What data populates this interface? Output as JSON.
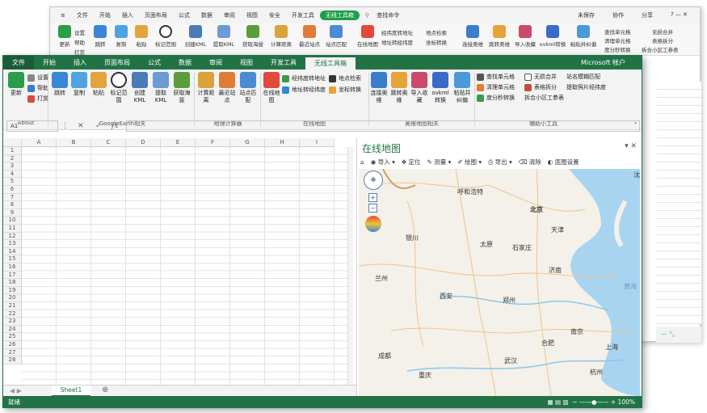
{
  "back_window": {
    "menu": [
      "文件",
      "开始",
      "插入",
      "页面布局",
      "公式",
      "数据",
      "审阅",
      "视图",
      "安全",
      "开发工具"
    ],
    "active_tab": "无线工具箱",
    "search": "查找命令",
    "right": [
      "未保存",
      "协作",
      "分享"
    ],
    "ribbon": {
      "b1": "更新",
      "b2": "设置",
      "b2b": "帮助",
      "b2c": "打赏",
      "b3": "跳转",
      "b4": "复制",
      "b5": "粘贴",
      "b6": "标记范围",
      "b7": "创建KML",
      "b8": "提取KML",
      "b9": "获取海拔",
      "b10": "计算距离",
      "b11": "最近站点",
      "b12": "站点匹配",
      "b13": "在线地图",
      "s1": "经纬度转地址",
      "s2": "地址转经纬度",
      "s3": "地点检索",
      "s4": "坐标转换",
      "b14": "连接奥维",
      "b15": "跳转奥维",
      "b16": "导入收藏",
      "b17": "ovkml转换",
      "b18": "粘贴并纠偏",
      "s5": "查找单元格",
      "s6": "清理单元格",
      "s7": "度分秒转换",
      "s8": "无损合并",
      "s9": "表格拆分",
      "s10": "拆合小区工参表"
    },
    "col": "T"
  },
  "tabs": [
    "文件",
    "开始",
    "插入",
    "页面布局",
    "公式",
    "数据",
    "审阅",
    "视图",
    "开发工具"
  ],
  "active_tab": "无线工具箱",
  "account": "Microsoft 帐户",
  "ribbon": {
    "update": "更新",
    "settings": "设置",
    "help": "帮助",
    "donate": "打赏",
    "about": "About",
    "jump": "跳转",
    "copy": "复制",
    "paste": "粘贴",
    "mark": "标记范围",
    "createkml": "创建KML",
    "extractkml": "提取KML",
    "altitude": "获取海拔",
    "group_ge": "GoogleEarth相关",
    "distance": "计算距离",
    "nearest": "最近站点",
    "match": "站点匹配",
    "group_calc": "地理计算器",
    "online": "在线地图",
    "geo2addr": "经纬度转地址",
    "addr2geo": "地址转经纬度",
    "poi": "地点检索",
    "coord": "坐标转换",
    "group_online": "在线地图",
    "ovconn": "连接奥维",
    "ovjump": "跳转奥维",
    "ovimport": "导入收藏",
    "ovkml": "ovkml转换",
    "ovpaste": "粘贴并纠偏",
    "group_ov": "奥维地图相关",
    "findcell": "查找单元格",
    "cleancell": "清理单元格",
    "dms": "度分秒转换",
    "merge": "无损合并",
    "split": "表格拆分",
    "splitcell": "拆合小区工参表",
    "stationmatch": "站名模糊匹配",
    "photo": "提取照片经纬度",
    "group_tools": "辅助小工具"
  },
  "namebox": "A1",
  "fx": "fx",
  "columns": [
    "A",
    "B",
    "C",
    "D",
    "E",
    "F",
    "G",
    "H",
    "I"
  ],
  "rows": [
    "1",
    "2",
    "3",
    "4",
    "5",
    "6",
    "7",
    "8",
    "9",
    "10",
    "11",
    "12",
    "13",
    "14",
    "15",
    "16",
    "17",
    "18",
    "19",
    "20",
    "21",
    "22",
    "23",
    "24",
    "25",
    "26",
    "27",
    "28"
  ],
  "sheet_tab": "Sheet1",
  "status": "就绪",
  "zoom": "100%",
  "pane": {
    "title": "在线地图",
    "tools": [
      "导入",
      "定位",
      "测量",
      "绘图",
      "导出",
      "清除",
      "底图设置"
    ],
    "cities": [
      "呼和浩特",
      "北京",
      "天津",
      "银川",
      "太原",
      "石家庄",
      "兰州",
      "济南",
      "西安",
      "郑州",
      "南京",
      "合肥",
      "上海",
      "成都",
      "武汉",
      "杭州",
      "重庆",
      "南昌",
      "长沙",
      "沈"
    ],
    "sea": "黄海"
  }
}
